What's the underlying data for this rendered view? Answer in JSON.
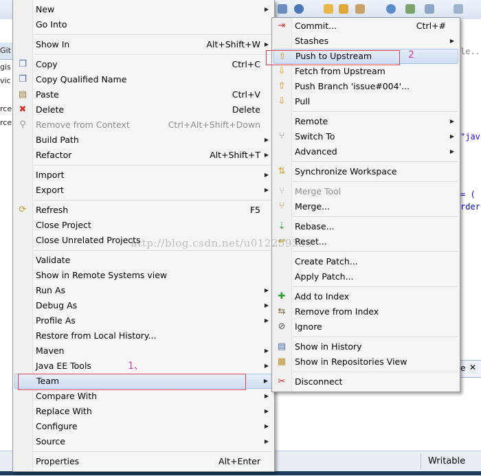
{
  "background": {
    "left_fragments": [
      "Git",
      "gis",
      "vic",
      "rce",
      "rce"
    ],
    "code_fragments": [
      "le...",
      "\"jav",
      "= (",
      "rder"
    ],
    "status_writable": "Writable",
    "panel_fragment": "e"
  },
  "main_menu": [
    {
      "label": "New",
      "shortcut": "",
      "submenu": true,
      "icon": ""
    },
    {
      "label": "Go Into",
      "shortcut": "",
      "submenu": false,
      "icon": ""
    },
    {
      "sep": true
    },
    {
      "label": "Show In",
      "shortcut": "Alt+Shift+W",
      "submenu": true,
      "icon": ""
    },
    {
      "sep": true
    },
    {
      "label": "Copy",
      "shortcut": "Ctrl+C",
      "submenu": false,
      "icon": "copy-icon"
    },
    {
      "label": "Copy Qualified Name",
      "shortcut": "",
      "submenu": false,
      "icon": "copy-qualified-icon"
    },
    {
      "label": "Paste",
      "shortcut": "Ctrl+V",
      "submenu": false,
      "icon": "paste-icon"
    },
    {
      "label": "Delete",
      "shortcut": "Delete",
      "submenu": false,
      "icon": "delete-icon"
    },
    {
      "label": "Remove from Context",
      "shortcut": "Ctrl+Alt+Shift+Down",
      "submenu": false,
      "icon": "remove-context-icon",
      "disabled": true
    },
    {
      "label": "Build Path",
      "shortcut": "",
      "submenu": true,
      "icon": ""
    },
    {
      "label": "Refactor",
      "shortcut": "Alt+Shift+T",
      "submenu": true,
      "icon": ""
    },
    {
      "sep": true
    },
    {
      "label": "Import",
      "shortcut": "",
      "submenu": true,
      "icon": ""
    },
    {
      "label": "Export",
      "shortcut": "",
      "submenu": true,
      "icon": ""
    },
    {
      "sep": true
    },
    {
      "label": "Refresh",
      "shortcut": "F5",
      "submenu": false,
      "icon": "refresh-icon"
    },
    {
      "label": "Close Project",
      "shortcut": "",
      "submenu": false,
      "icon": ""
    },
    {
      "label": "Close Unrelated Projects",
      "shortcut": "",
      "submenu": false,
      "icon": ""
    },
    {
      "sep": true
    },
    {
      "label": "Validate",
      "shortcut": "",
      "submenu": false,
      "icon": ""
    },
    {
      "label": "Show in Remote Systems view",
      "shortcut": "",
      "submenu": false,
      "icon": ""
    },
    {
      "label": "Run As",
      "shortcut": "",
      "submenu": true,
      "icon": ""
    },
    {
      "label": "Debug As",
      "shortcut": "",
      "submenu": true,
      "icon": ""
    },
    {
      "label": "Profile As",
      "shortcut": "",
      "submenu": true,
      "icon": ""
    },
    {
      "label": "Restore from Local History...",
      "shortcut": "",
      "submenu": false,
      "icon": ""
    },
    {
      "label": "Maven",
      "shortcut": "",
      "submenu": true,
      "icon": ""
    },
    {
      "label": "Java EE Tools",
      "shortcut": "",
      "submenu": true,
      "icon": ""
    },
    {
      "label": "Team",
      "shortcut": "",
      "submenu": true,
      "icon": "",
      "highlighted": true
    },
    {
      "label": "Compare With",
      "shortcut": "",
      "submenu": true,
      "icon": ""
    },
    {
      "label": "Replace With",
      "shortcut": "",
      "submenu": true,
      "icon": ""
    },
    {
      "label": "Configure",
      "shortcut": "",
      "submenu": true,
      "icon": ""
    },
    {
      "label": "Source",
      "shortcut": "",
      "submenu": true,
      "icon": ""
    },
    {
      "sep": true
    },
    {
      "label": "Properties",
      "shortcut": "Alt+Enter",
      "submenu": false,
      "icon": ""
    }
  ],
  "team_menu": [
    {
      "label": "Commit...",
      "shortcut": "Ctrl+#",
      "submenu": false,
      "icon": "commit-icon"
    },
    {
      "label": "Stashes",
      "shortcut": "",
      "submenu": true,
      "icon": ""
    },
    {
      "label": "Push to Upstream",
      "shortcut": "",
      "submenu": false,
      "icon": "push-upstream-icon",
      "highlighted": true
    },
    {
      "label": "Fetch from Upstream",
      "shortcut": "",
      "submenu": false,
      "icon": "fetch-upstream-icon"
    },
    {
      "label": "Push Branch 'issue#004'...",
      "shortcut": "",
      "submenu": false,
      "icon": "push-branch-icon"
    },
    {
      "label": "Pull",
      "shortcut": "",
      "submenu": false,
      "icon": "pull-icon"
    },
    {
      "sep": true
    },
    {
      "label": "Remote",
      "shortcut": "",
      "submenu": true,
      "icon": ""
    },
    {
      "label": "Switch To",
      "shortcut": "",
      "submenu": true,
      "icon": "switch-branch-icon"
    },
    {
      "label": "Advanced",
      "shortcut": "",
      "submenu": true,
      "icon": ""
    },
    {
      "sep": true
    },
    {
      "label": "Synchronize Workspace",
      "shortcut": "",
      "submenu": false,
      "icon": "synchronize-icon"
    },
    {
      "sep": true
    },
    {
      "label": "Merge Tool",
      "shortcut": "",
      "submenu": false,
      "icon": "merge-tool-icon",
      "disabled": true
    },
    {
      "label": "Merge...",
      "shortcut": "",
      "submenu": false,
      "icon": "merge-icon"
    },
    {
      "sep": true
    },
    {
      "label": "Rebase...",
      "shortcut": "",
      "submenu": false,
      "icon": "rebase-icon"
    },
    {
      "label": "Reset...",
      "shortcut": "",
      "submenu": false,
      "icon": "reset-icon"
    },
    {
      "sep": true
    },
    {
      "label": "Create Patch...",
      "shortcut": "",
      "submenu": false,
      "icon": ""
    },
    {
      "label": "Apply Patch...",
      "shortcut": "",
      "submenu": false,
      "icon": ""
    },
    {
      "sep": true
    },
    {
      "label": "Add to Index",
      "shortcut": "",
      "submenu": false,
      "icon": "add-index-icon"
    },
    {
      "label": "Remove from Index",
      "shortcut": "",
      "submenu": false,
      "icon": "remove-index-icon"
    },
    {
      "label": "Ignore",
      "shortcut": "",
      "submenu": false,
      "icon": "ignore-icon"
    },
    {
      "sep": true
    },
    {
      "label": "Show in History",
      "shortcut": "",
      "submenu": false,
      "icon": "history-icon"
    },
    {
      "label": "Show in Repositories View",
      "shortcut": "",
      "submenu": false,
      "icon": "repositories-icon"
    },
    {
      "sep": true
    },
    {
      "label": "Disconnect",
      "shortcut": "",
      "submenu": false,
      "icon": "disconnect-icon"
    }
  ],
  "annotations": {
    "label_1": "1、",
    "label_2": "2"
  },
  "watermark": "http://blog.csdn.net/u012259539",
  "colors": {
    "highlight": "#cfdef2",
    "annotation_box": "#e04050",
    "annotation_text": "#d63aa6"
  }
}
